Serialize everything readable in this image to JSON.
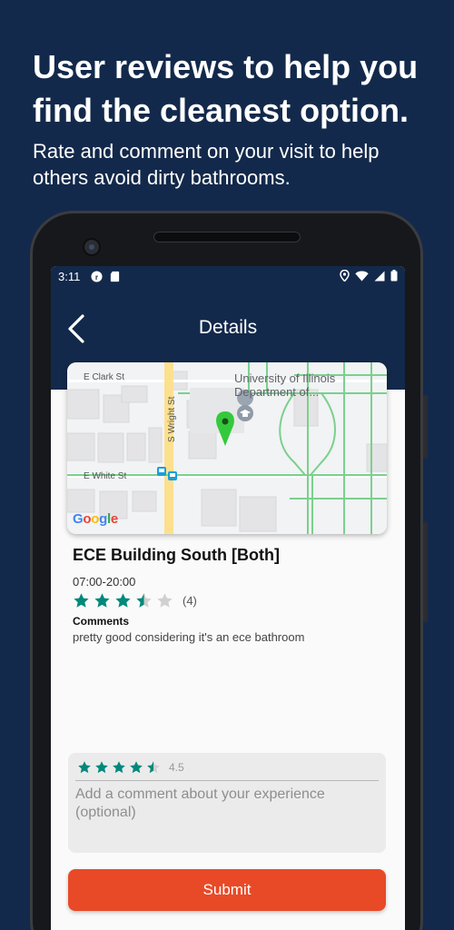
{
  "promo": {
    "headline": "User reviews to help you find the cleanest option.",
    "subline": "Rate and comment on your visit to help others avoid dirty bathrooms."
  },
  "status_bar": {
    "time": "3:11"
  },
  "header": {
    "title": "Details"
  },
  "map": {
    "street_labels": {
      "clark": "E Clark St",
      "wright": "S Wright St",
      "white": "E White St"
    },
    "poi_label": "University of Illinois Department of...",
    "attribution": "Google"
  },
  "place": {
    "name": "ECE Building South [Both]",
    "hours": "07:00-20:00",
    "rating": 3.5,
    "review_count": "(4)",
    "comments_heading": "Comments",
    "comment": "pretty good considering it's an ece bathroom"
  },
  "review_form": {
    "rating": 4.5,
    "rating_label": "4.5",
    "comment_placeholder": "Add a comment about your experience (optional)",
    "submit_label": "Submit"
  },
  "colors": {
    "navy": "#13294b",
    "accent_orange": "#e84a27",
    "star_green": "#00897b",
    "star_empty": "#d0d0d0"
  },
  "icons": [
    "back-arrow-icon",
    "location-icon",
    "wifi-icon",
    "signal-icon",
    "battery-icon",
    "map-pin-icon",
    "graduation-cap-icon",
    "bus-stop-icon",
    "star-icon"
  ]
}
